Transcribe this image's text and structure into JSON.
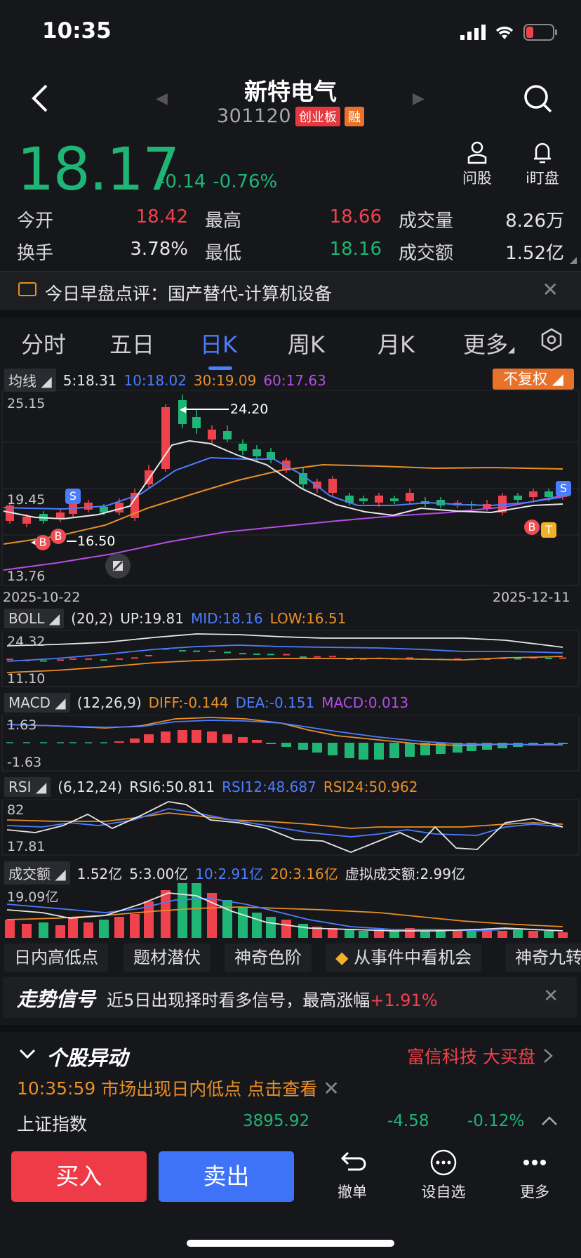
{
  "status": {
    "time": "10:35"
  },
  "header": {
    "name": "新特电气",
    "code": "301120",
    "board_tag": "创业板",
    "margin_tag": "融"
  },
  "quote": {
    "price": "18.17",
    "change": "-0.14",
    "change_pct": "-0.76%",
    "ask_label": "问股",
    "watch_label": "i盯盘"
  },
  "stats": {
    "open_label": "今开",
    "open": "18.42",
    "high_label": "最高",
    "high": "18.66",
    "volume_label": "成交量",
    "volume": "8.26万",
    "turnover_label": "换手",
    "turnover": "3.78%",
    "low_label": "最低",
    "low": "18.16",
    "amount_label": "成交额",
    "amount": "1.52亿"
  },
  "news": {
    "text": "今日早盘点评：国产替代-计算机设备"
  },
  "tabs": [
    "分时",
    "五日",
    "日K",
    "周K",
    "月K",
    "更多"
  ],
  "active_tab": "日K",
  "ma": {
    "btn": "均线",
    "ma5": "5:18.31",
    "ma10": "10:18.02",
    "ma30": "30:19.09",
    "ma60": "60:17.63",
    "adjust": "不复权"
  },
  "kline": {
    "y_top": "25.15",
    "y_mid": "19.45",
    "y_bot": "13.76",
    "max_label": "24.20",
    "min_label": "16.50",
    "date_start": "2025-10-22",
    "date_end": "2025-12-11",
    "marker_s": "S",
    "marker_b": "B",
    "marker_t": "T"
  },
  "boll": {
    "btn": "BOLL",
    "params": "(20,2)",
    "up": "UP:19.81",
    "mid": "MID:18.16",
    "low": "LOW:16.51",
    "y_top": "24.32",
    "y_bot": "11.10"
  },
  "macd": {
    "btn": "MACD",
    "params": "(12,26,9)",
    "diff": "DIFF:-0.144",
    "dea": "DEA:-0.151",
    "macd": "MACD:0.013",
    "y_top": "1.63",
    "y_bot": "-1.63"
  },
  "rsi": {
    "btn": "RSI",
    "params": "(6,12,24)",
    "rsi6": "RSI6:50.811",
    "rsi12": "RSI12:48.687",
    "rsi24": "RSI24:50.962",
    "y_top": "82",
    "y_bot": "17.81"
  },
  "vol": {
    "btn": "成交额",
    "value": "1.52亿",
    "ma5": "5:3.00亿",
    "ma10": "10:2.91亿",
    "ma20": "20:3.16亿",
    "virtual": "虚拟成交额:2.99亿",
    "y_top": "19.09亿"
  },
  "chips": [
    "日内高低点",
    "题材潜伏",
    "神奇色阶",
    "从事件中看机会",
    "神奇九转"
  ],
  "signal": {
    "title": "走势信号",
    "text": "近5日出现择时看多信号，最高涨幅",
    "pct": "+1.91%"
  },
  "movement": {
    "title": "个股异动",
    "related": "富信科技 大买盘",
    "time": "10:35:59",
    "event": "市场出现日内低点",
    "link": "点击查看"
  },
  "index": {
    "name": "上证指数",
    "value": "3895.92",
    "change": "-4.58",
    "pct": "-0.12%"
  },
  "bottom": {
    "buy": "买入",
    "sell": "卖出",
    "cancel": "撤单",
    "favorite": "设自选",
    "more": "更多"
  },
  "colors": {
    "up": "#f0424c",
    "down": "#1fb575",
    "ma5": "#e6e6e6",
    "ma10": "#4b7dff",
    "ma30": "#e88f27",
    "ma60": "#b54de6"
  }
}
